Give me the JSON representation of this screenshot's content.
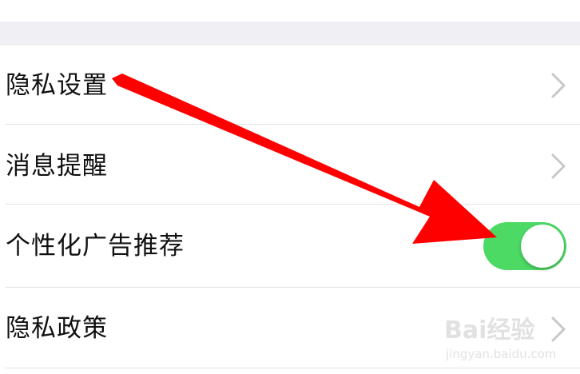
{
  "settings": {
    "items": [
      {
        "label": "隐私设置",
        "control": "chevron"
      },
      {
        "label": "消息提醒",
        "control": "chevron"
      },
      {
        "label": "个性化广告推荐",
        "control": "toggle",
        "toggle_on": true
      },
      {
        "label": "隐私政策",
        "control": "chevron"
      }
    ]
  },
  "colors": {
    "toggle_on": "#4cd964",
    "annotation_arrow": "#ff0000",
    "group_background": "#efeff4"
  },
  "watermark": {
    "brand": "Bai经验",
    "url": "jingyan.baidu.com"
  },
  "icons": {
    "chevron": "chevron-right-icon",
    "annotation": "red-arrow-annotation",
    "watermark_logo": "baidu-paw-icon"
  }
}
